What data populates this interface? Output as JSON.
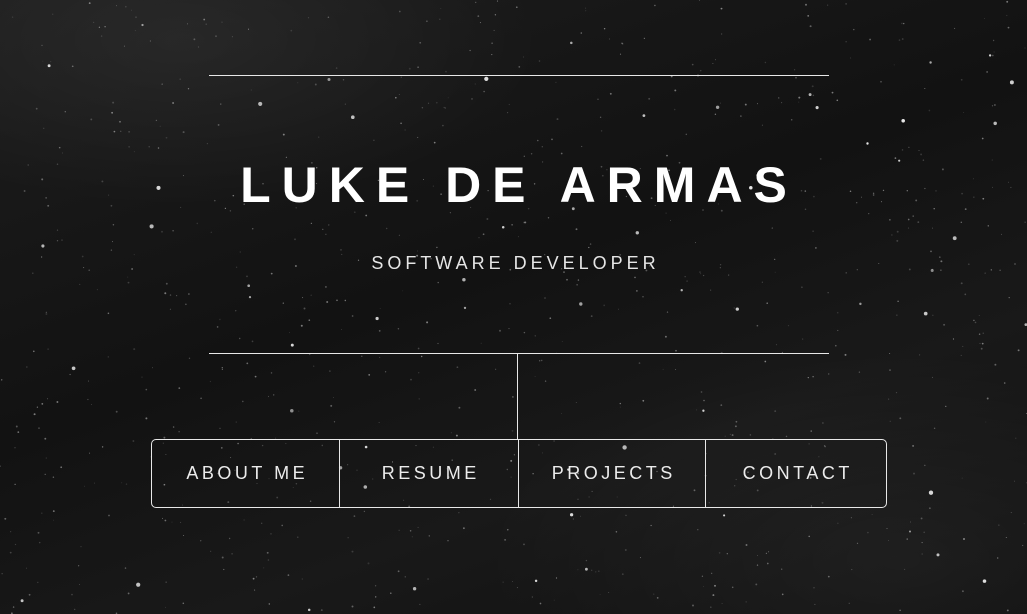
{
  "header": {
    "name": "LUKE DE ARMAS",
    "role": "SOFTWARE DEVELOPER"
  },
  "nav": {
    "items": [
      {
        "label": "ABOUT ME"
      },
      {
        "label": "RESUME"
      },
      {
        "label": "PROJECTS"
      },
      {
        "label": "CONTACT"
      }
    ]
  },
  "colors": {
    "background": "#141414",
    "text": "#ffffff",
    "lines": "#e8e8e8"
  }
}
